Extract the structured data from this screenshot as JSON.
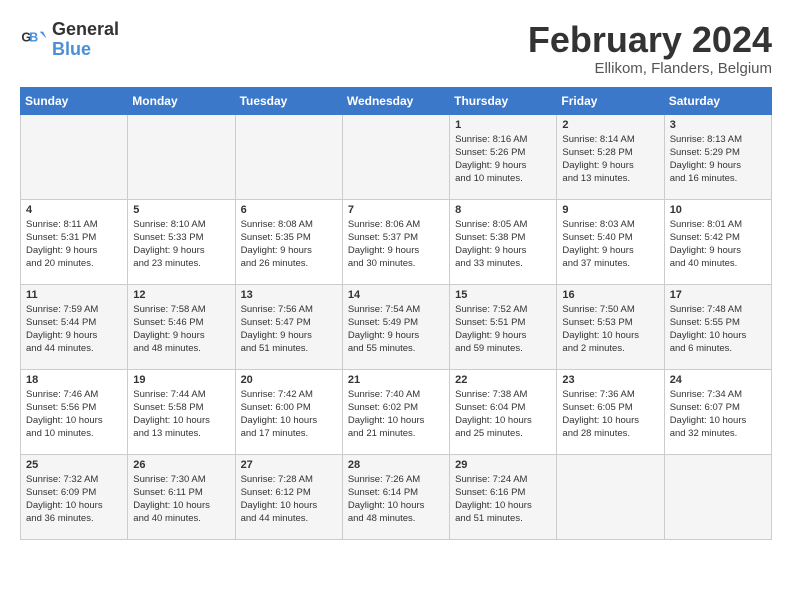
{
  "header": {
    "logo_line1": "General",
    "logo_line2": "Blue",
    "month": "February 2024",
    "location": "Ellikom, Flanders, Belgium"
  },
  "weekdays": [
    "Sunday",
    "Monday",
    "Tuesday",
    "Wednesday",
    "Thursday",
    "Friday",
    "Saturday"
  ],
  "weeks": [
    [
      {
        "day": "",
        "info": ""
      },
      {
        "day": "",
        "info": ""
      },
      {
        "day": "",
        "info": ""
      },
      {
        "day": "",
        "info": ""
      },
      {
        "day": "1",
        "info": "Sunrise: 8:16 AM\nSunset: 5:26 PM\nDaylight: 9 hours\nand 10 minutes."
      },
      {
        "day": "2",
        "info": "Sunrise: 8:14 AM\nSunset: 5:28 PM\nDaylight: 9 hours\nand 13 minutes."
      },
      {
        "day": "3",
        "info": "Sunrise: 8:13 AM\nSunset: 5:29 PM\nDaylight: 9 hours\nand 16 minutes."
      }
    ],
    [
      {
        "day": "4",
        "info": "Sunrise: 8:11 AM\nSunset: 5:31 PM\nDaylight: 9 hours\nand 20 minutes."
      },
      {
        "day": "5",
        "info": "Sunrise: 8:10 AM\nSunset: 5:33 PM\nDaylight: 9 hours\nand 23 minutes."
      },
      {
        "day": "6",
        "info": "Sunrise: 8:08 AM\nSunset: 5:35 PM\nDaylight: 9 hours\nand 26 minutes."
      },
      {
        "day": "7",
        "info": "Sunrise: 8:06 AM\nSunset: 5:37 PM\nDaylight: 9 hours\nand 30 minutes."
      },
      {
        "day": "8",
        "info": "Sunrise: 8:05 AM\nSunset: 5:38 PM\nDaylight: 9 hours\nand 33 minutes."
      },
      {
        "day": "9",
        "info": "Sunrise: 8:03 AM\nSunset: 5:40 PM\nDaylight: 9 hours\nand 37 minutes."
      },
      {
        "day": "10",
        "info": "Sunrise: 8:01 AM\nSunset: 5:42 PM\nDaylight: 9 hours\nand 40 minutes."
      }
    ],
    [
      {
        "day": "11",
        "info": "Sunrise: 7:59 AM\nSunset: 5:44 PM\nDaylight: 9 hours\nand 44 minutes."
      },
      {
        "day": "12",
        "info": "Sunrise: 7:58 AM\nSunset: 5:46 PM\nDaylight: 9 hours\nand 48 minutes."
      },
      {
        "day": "13",
        "info": "Sunrise: 7:56 AM\nSunset: 5:47 PM\nDaylight: 9 hours\nand 51 minutes."
      },
      {
        "day": "14",
        "info": "Sunrise: 7:54 AM\nSunset: 5:49 PM\nDaylight: 9 hours\nand 55 minutes."
      },
      {
        "day": "15",
        "info": "Sunrise: 7:52 AM\nSunset: 5:51 PM\nDaylight: 9 hours\nand 59 minutes."
      },
      {
        "day": "16",
        "info": "Sunrise: 7:50 AM\nSunset: 5:53 PM\nDaylight: 10 hours\nand 2 minutes."
      },
      {
        "day": "17",
        "info": "Sunrise: 7:48 AM\nSunset: 5:55 PM\nDaylight: 10 hours\nand 6 minutes."
      }
    ],
    [
      {
        "day": "18",
        "info": "Sunrise: 7:46 AM\nSunset: 5:56 PM\nDaylight: 10 hours\nand 10 minutes."
      },
      {
        "day": "19",
        "info": "Sunrise: 7:44 AM\nSunset: 5:58 PM\nDaylight: 10 hours\nand 13 minutes."
      },
      {
        "day": "20",
        "info": "Sunrise: 7:42 AM\nSunset: 6:00 PM\nDaylight: 10 hours\nand 17 minutes."
      },
      {
        "day": "21",
        "info": "Sunrise: 7:40 AM\nSunset: 6:02 PM\nDaylight: 10 hours\nand 21 minutes."
      },
      {
        "day": "22",
        "info": "Sunrise: 7:38 AM\nSunset: 6:04 PM\nDaylight: 10 hours\nand 25 minutes."
      },
      {
        "day": "23",
        "info": "Sunrise: 7:36 AM\nSunset: 6:05 PM\nDaylight: 10 hours\nand 28 minutes."
      },
      {
        "day": "24",
        "info": "Sunrise: 7:34 AM\nSunset: 6:07 PM\nDaylight: 10 hours\nand 32 minutes."
      }
    ],
    [
      {
        "day": "25",
        "info": "Sunrise: 7:32 AM\nSunset: 6:09 PM\nDaylight: 10 hours\nand 36 minutes."
      },
      {
        "day": "26",
        "info": "Sunrise: 7:30 AM\nSunset: 6:11 PM\nDaylight: 10 hours\nand 40 minutes."
      },
      {
        "day": "27",
        "info": "Sunrise: 7:28 AM\nSunset: 6:12 PM\nDaylight: 10 hours\nand 44 minutes."
      },
      {
        "day": "28",
        "info": "Sunrise: 7:26 AM\nSunset: 6:14 PM\nDaylight: 10 hours\nand 48 minutes."
      },
      {
        "day": "29",
        "info": "Sunrise: 7:24 AM\nSunset: 6:16 PM\nDaylight: 10 hours\nand 51 minutes."
      },
      {
        "day": "",
        "info": ""
      },
      {
        "day": "",
        "info": ""
      }
    ]
  ]
}
